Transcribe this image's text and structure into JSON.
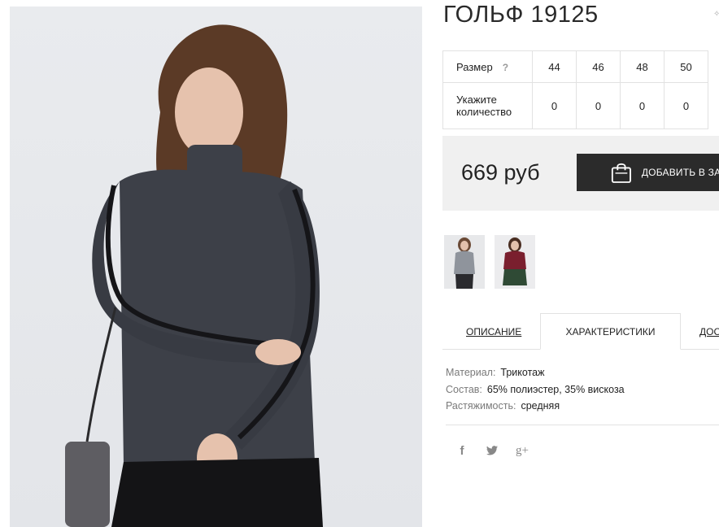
{
  "product": {
    "title": "ГОЛЬФ 19125",
    "title_mark": "✨",
    "main_image_alt": "model in dark sparkle turtleneck with studded ribbon sleeves"
  },
  "sizes": {
    "size_label": "Размер",
    "help": "?",
    "values": [
      "44",
      "46",
      "48",
      "50"
    ],
    "qty_label_line1": "Укажите",
    "qty_label_line2": "количество",
    "quantities": [
      "0",
      "0",
      "0",
      "0"
    ]
  },
  "purchase": {
    "price": "669 руб",
    "add_to_cart": "ДОБАВИТЬ В ЗАКАЗ"
  },
  "tabs": {
    "description": "ОПИСАНИЕ",
    "characteristics": "ХАРАКТЕРИСТИКИ",
    "delivery": "ДОСТАВКА"
  },
  "specs": [
    {
      "key": "Материал:",
      "value": "Трикотаж"
    },
    {
      "key": "Состав:",
      "value": "65% полиэстер, 35% вискоза"
    },
    {
      "key": "Растяжимость:",
      "value": "средняя"
    }
  ],
  "social": {
    "facebook": "f",
    "google": "g+"
  },
  "colors": {
    "button_bg": "#2b2b2b",
    "price_bg": "#f0f0f0",
    "border": "#e2e2e2",
    "sweater": "#3d4048",
    "burgundy": "#7a1f2e",
    "green_skirt": "#2f4a35"
  }
}
